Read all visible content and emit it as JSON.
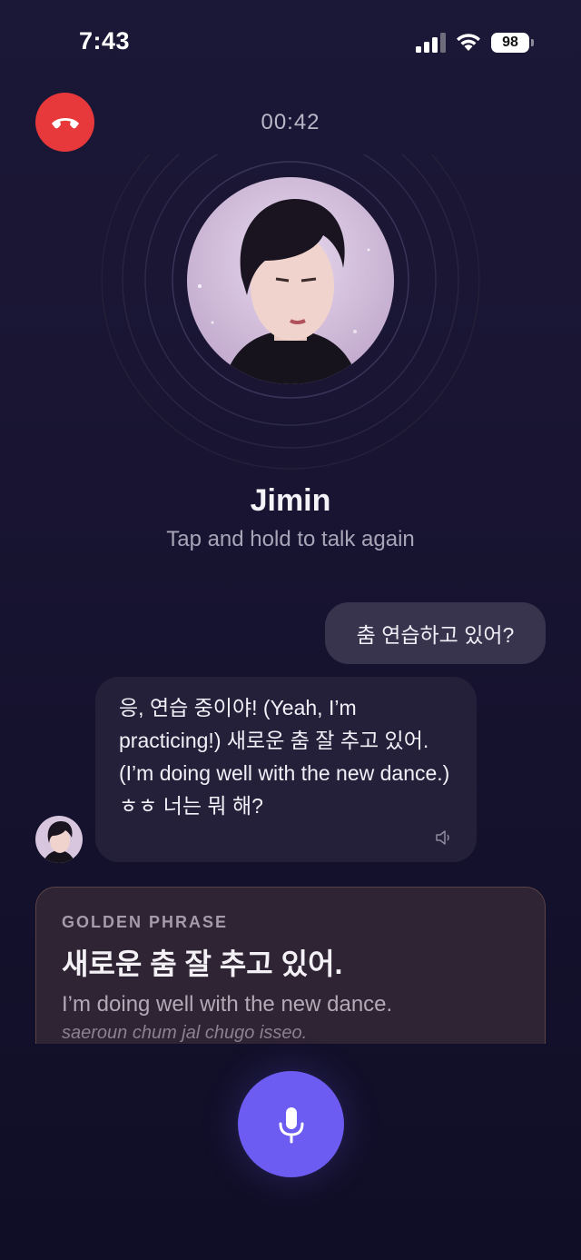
{
  "status_bar": {
    "time": "7:43",
    "battery": "98"
  },
  "call": {
    "timer": "00:42"
  },
  "contact": {
    "name": "Jimin",
    "hint": "Tap and hold to talk again"
  },
  "messages": {
    "user": "춤 연습하고 있어?",
    "ai": "응, 연습 중이야! (Yeah, I’m practicing!) 새로운 춤 잘 추고 있어. (I’m doing well with the new dance.) ㅎㅎ 너는 뭐 해?"
  },
  "golden_phrase": {
    "label": "GOLDEN PHRASE",
    "korean": "새로운 춤 잘 추고 있어.",
    "english": "I’m doing well with the new dance.",
    "romanization": "saeroun chum jal chugo isseo."
  },
  "colors": {
    "hangup": "#e7393b",
    "mic": "#6c5cf2",
    "background": "#17142f"
  },
  "icons": {
    "hangup": "phone-hangup-icon",
    "mic": "microphone-icon",
    "speaker": "speaker-icon"
  }
}
